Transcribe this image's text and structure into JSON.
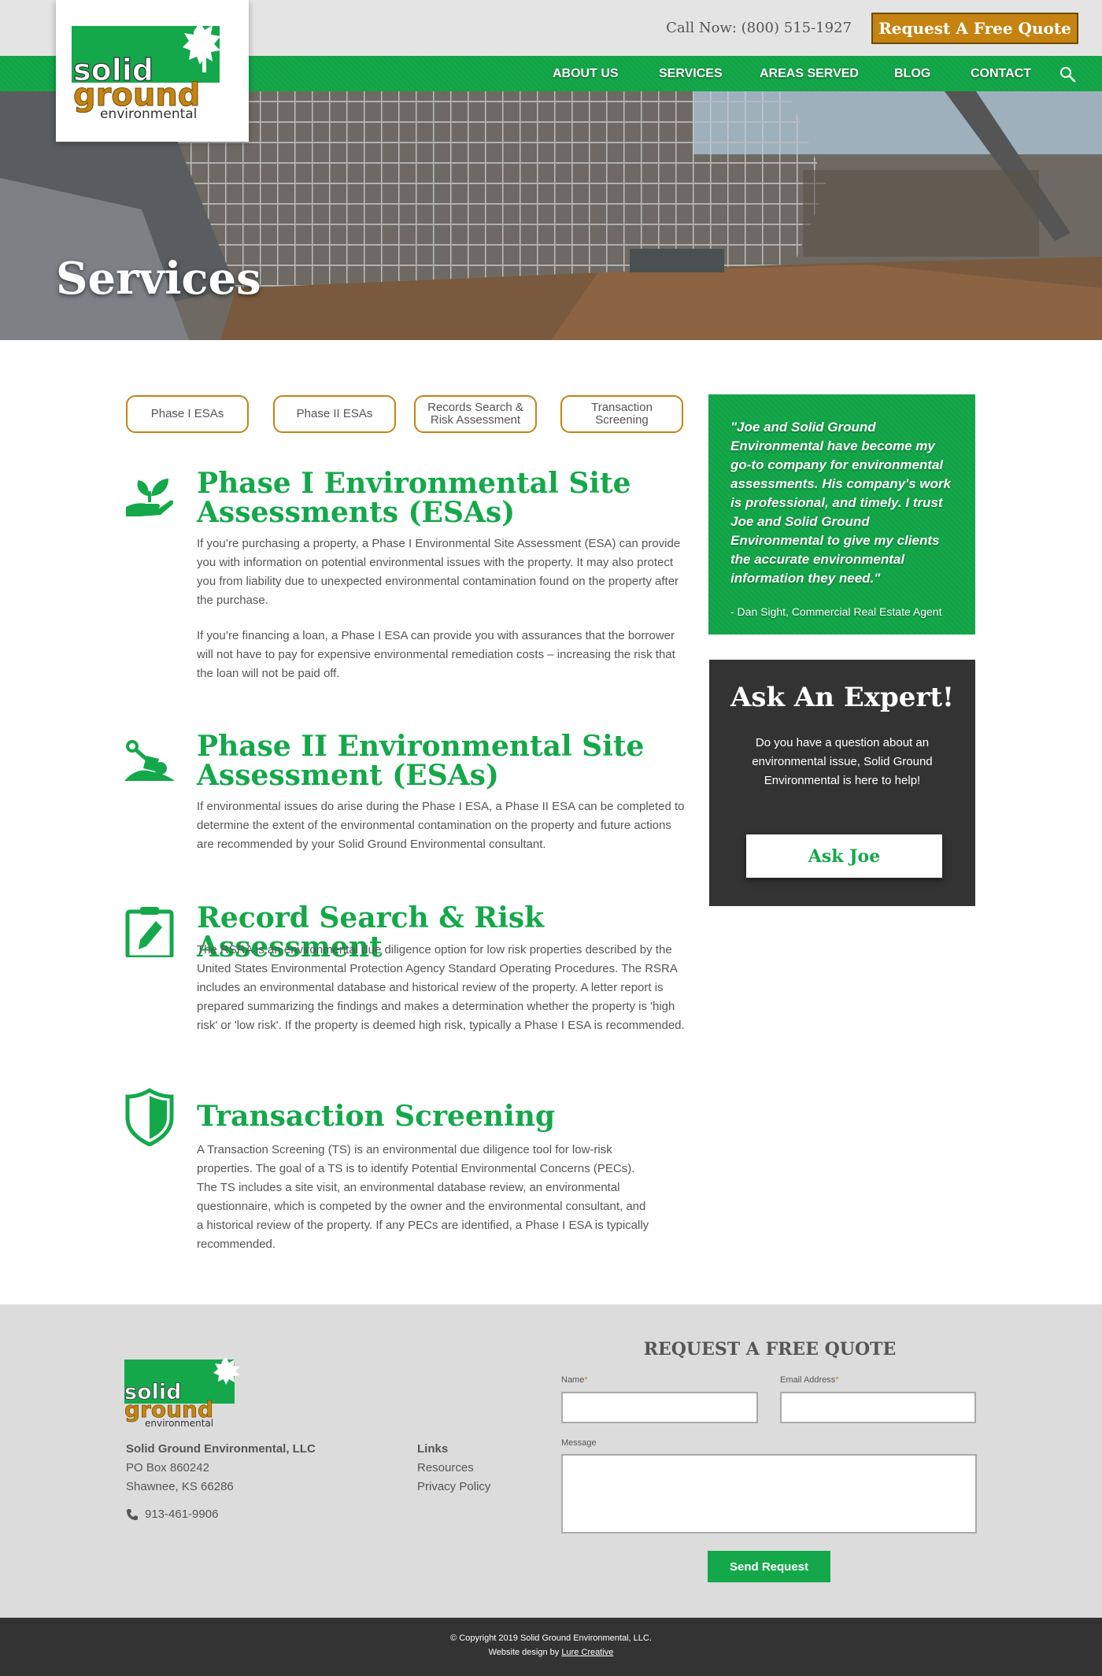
{
  "header": {
    "call_label": "Call Now:",
    "phone": "(800) 515-1927",
    "quote_button": "Request A Free Quote",
    "logo": {
      "word1": "solid",
      "word2": "ground",
      "word3": "environmental"
    },
    "nav": [
      "ABOUT US",
      "SERVICES",
      "AREAS SERVED",
      "BLOG",
      "CONTACT"
    ]
  },
  "hero": {
    "title": "Services"
  },
  "tabs": [
    {
      "label": "Phase I ESAs"
    },
    {
      "label": "Phase II ESAs"
    },
    {
      "label": "Records Search & Risk Assessment"
    },
    {
      "label": "Transaction Screening"
    }
  ],
  "sections": [
    {
      "icon": "plant-in-hand-icon",
      "title": "Phase I Environmental Site Assessments (ESAs)",
      "paragraphs": [
        "If you’re purchasing a property, a Phase I Environmental Site Assessment (ESA) can provide you with information on potential environmental issues with the property.  It may also protect you from liability due to unexpected environmental contamination found on the property after the purchase.",
        "If you’re financing a loan, a Phase I ESA can provide you with assurances that the borrower will not have to pay for expensive environmental remediation costs – increasing the risk that the loan will not be paid off."
      ]
    },
    {
      "icon": "trowel-soil-icon",
      "title": "Phase II Environmental Site Assessment (ESAs)",
      "paragraphs": [
        "If environmental issues do arise during the Phase I ESA, a Phase II ESA can be completed to determine the extent of the environmental contamination on the property and future actions are recommended by your Solid Ground Environmental consultant."
      ]
    },
    {
      "icon": "clipboard-pencil-icon",
      "title": "Record Search & Risk Assessment",
      "paragraphs": [
        "The RSRA is an environmental due diligence option for low risk properties described by the United States Environmental Protection Agency Standard Operating Procedures. The RSRA includes an environmental database and historical review of the property. A letter report is prepared summarizing the findings and makes a determination whether the property is 'high risk' or 'low risk'. If the property is deemed high risk, typically a Phase I ESA is recommended."
      ]
    },
    {
      "icon": "shield-icon",
      "title": "Transaction Screening",
      "paragraphs": [
        "A Transaction Screening (TS) is an environmental due diligence tool for low-risk properties. The goal of a TS is to identify Potential Environmental Concerns (PECs). The TS includes a site visit, an environmental database review, an environmental questionnaire, which is competed by the owner and the environmental consultant, and a historical review of the property. If any PECs are identified, a Phase I ESA is typically recommended."
      ]
    }
  ],
  "testimonial": {
    "quote": "\"Joe and Solid Ground Environmental have become my go-to company for environmental assessments. His company's work is professional, and timely. I trust Joe and Solid Ground Environmental to give my clients the accurate environmental information they need.\"",
    "author": "- Dan Sight, Commercial Real Estate Agent"
  },
  "expert": {
    "title": "Ask An Expert!",
    "text": "Do you have a question about an environmental issue, Solid Ground Environmental is here to help!",
    "button": "Ask Joe"
  },
  "footer": {
    "company": "Solid Ground Environmental, LLC",
    "address1": "PO Box 860242",
    "address2": "Shawnee, KS 66286",
    "phone": "913-461-9906",
    "links_title": "Links",
    "links": [
      "Resources",
      "Privacy Policy"
    ],
    "form": {
      "title": "REQUEST A FREE QUOTE",
      "name_label": "Name",
      "email_label": "Email Address",
      "message_label": "Message",
      "required_mark": "*",
      "send": "Send Request"
    },
    "copyright": "© Copyright 2019 Solid Ground Environmental, LLC.",
    "design_prefix": "Website design by",
    "design_link": "Lure Creative"
  },
  "colors": {
    "green": "#14a84a",
    "gold": "#c58412",
    "dark": "#333333",
    "footer_bg": "#dcdcdc"
  }
}
